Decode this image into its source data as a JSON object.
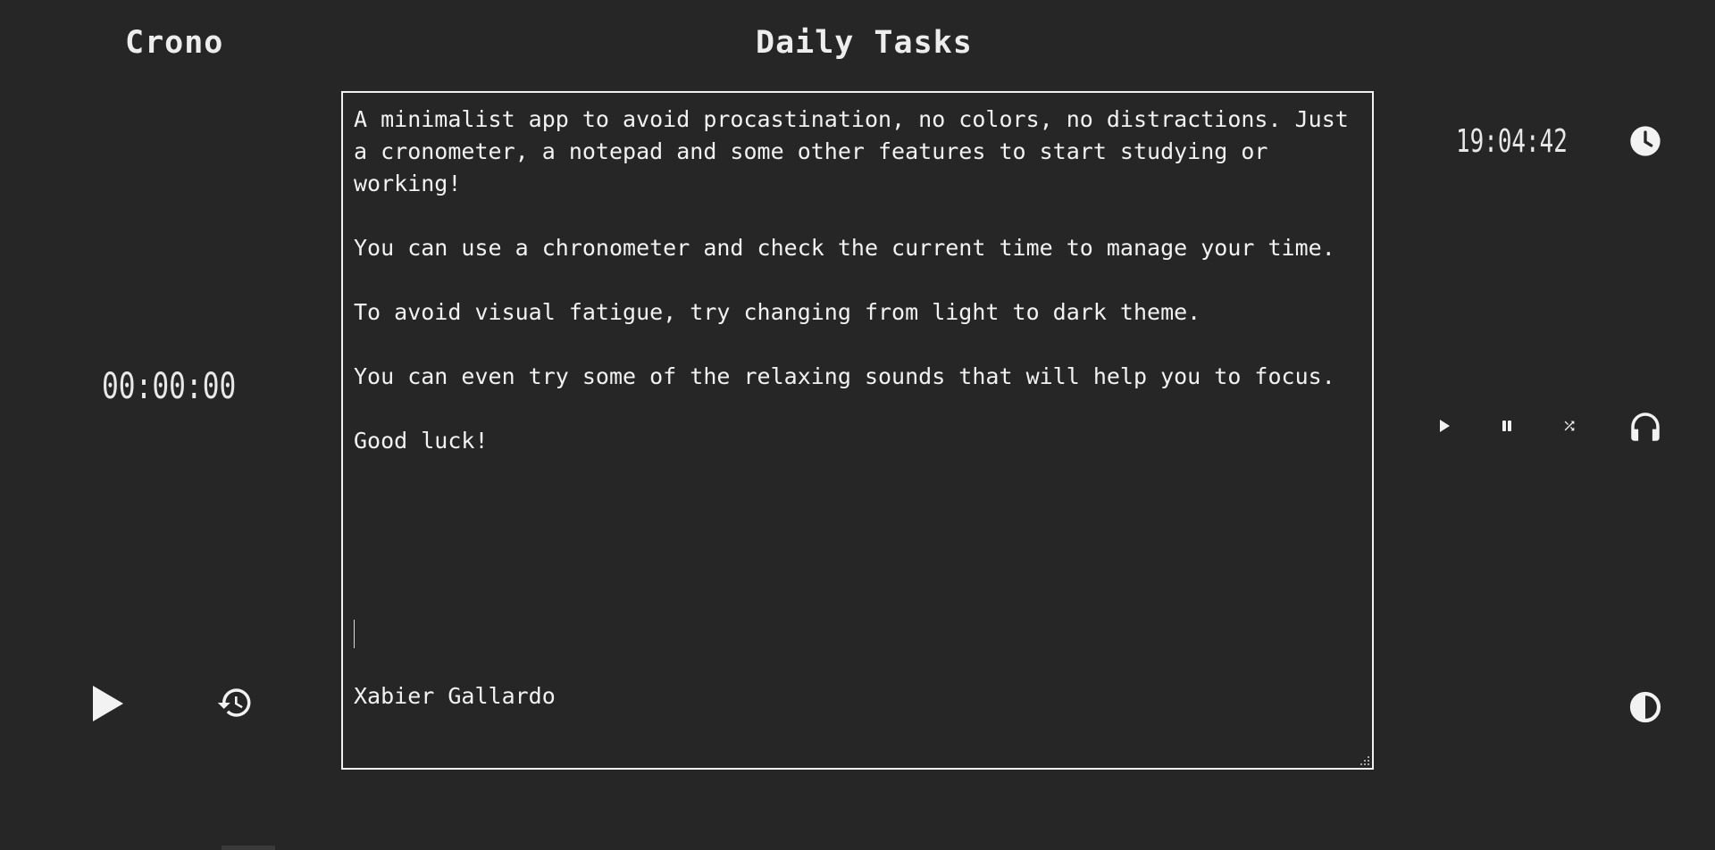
{
  "header": {
    "app_title": "Crono",
    "page_title": "Daily Tasks"
  },
  "chronometer": {
    "display": "00:00:00",
    "play_icon": "play-icon",
    "reset_icon": "history-reset-icon"
  },
  "clock": {
    "time": "19:04:42",
    "icon": "clock-icon"
  },
  "sounds": {
    "play_icon": "play-icon",
    "pause_icon": "pause-icon",
    "shuffle_icon": "shuffle-icon",
    "headphones_icon": "headphones-icon"
  },
  "theme": {
    "toggle_icon": "contrast-icon"
  },
  "notepad": {
    "content": "A minimalist app to avoid procastination, no colors, no distractions. Just a cronometer, a notepad and some other features to start studying or working!\n\nYou can use a chronometer and check the current time to manage your time.\n\nTo avoid visual fatigue, try changing from light to dark theme.\n\nYou can even try some of the relaxing sounds that will help you to focus.\n\nGood luck!",
    "signature": "Xabier Gallardo"
  },
  "colors": {
    "background": "#262626",
    "foreground": "#eaeaea"
  }
}
